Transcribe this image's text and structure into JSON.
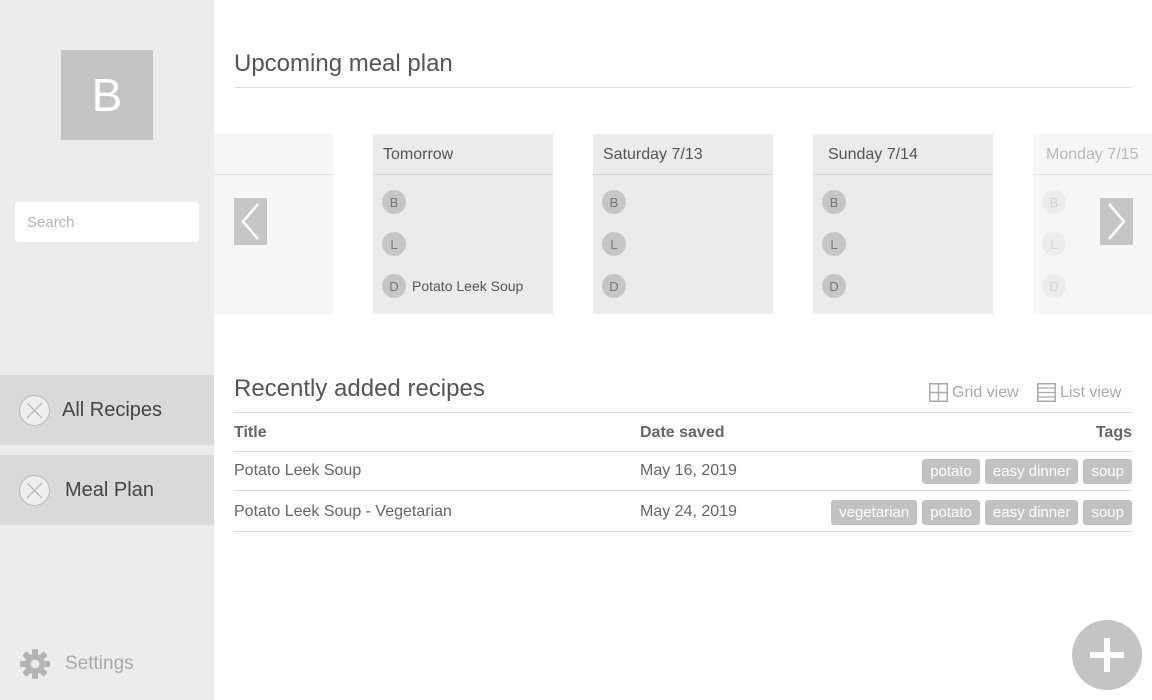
{
  "sidebar": {
    "avatar_letter": "B",
    "search_placeholder": "Search",
    "nav": [
      {
        "label": "All Recipes"
      },
      {
        "label": "Meal Plan"
      }
    ],
    "settings_label": "Settings"
  },
  "meal_plan": {
    "title": "Upcoming meal plan",
    "days": [
      {
        "label": "",
        "meals": []
      },
      {
        "label": "Tomorrow",
        "meals": [
          {
            "badge": "B",
            "name": ""
          },
          {
            "badge": "L",
            "name": ""
          },
          {
            "badge": "D",
            "name": "Potato Leek Soup"
          }
        ]
      },
      {
        "label": "Saturday 7/13",
        "meals": [
          {
            "badge": "B",
            "name": ""
          },
          {
            "badge": "L",
            "name": ""
          },
          {
            "badge": "D",
            "name": ""
          }
        ]
      },
      {
        "label": "Sunday 7/14",
        "meals": [
          {
            "badge": "B",
            "name": ""
          },
          {
            "badge": "L",
            "name": ""
          },
          {
            "badge": "D",
            "name": ""
          }
        ]
      },
      {
        "label": "Monday 7/15",
        "meals": [
          {
            "badge": "B",
            "name": ""
          },
          {
            "badge": "L",
            "name": ""
          },
          {
            "badge": "D",
            "name": ""
          }
        ]
      }
    ]
  },
  "recent": {
    "title": "Recently added recipes",
    "grid_view_label": "Grid view",
    "list_view_label": "List view",
    "columns": {
      "title": "Title",
      "date": "Date saved",
      "tags": "Tags"
    },
    "rows": [
      {
        "title": "Potato Leek Soup",
        "date": "May 16, 2019",
        "tags": [
          "potato",
          "easy dinner",
          "soup"
        ]
      },
      {
        "title": "Potato Leek Soup - Vegetarian",
        "date": "May 24, 2019",
        "tags": [
          "vegetarian",
          "potato",
          "easy dinner",
          "soup"
        ]
      }
    ]
  },
  "icons": {
    "nav": "close-circle-icon",
    "settings": "gear-icon",
    "prev": "chevron-left-icon",
    "next": "chevron-right-icon",
    "add": "plus-icon"
  }
}
